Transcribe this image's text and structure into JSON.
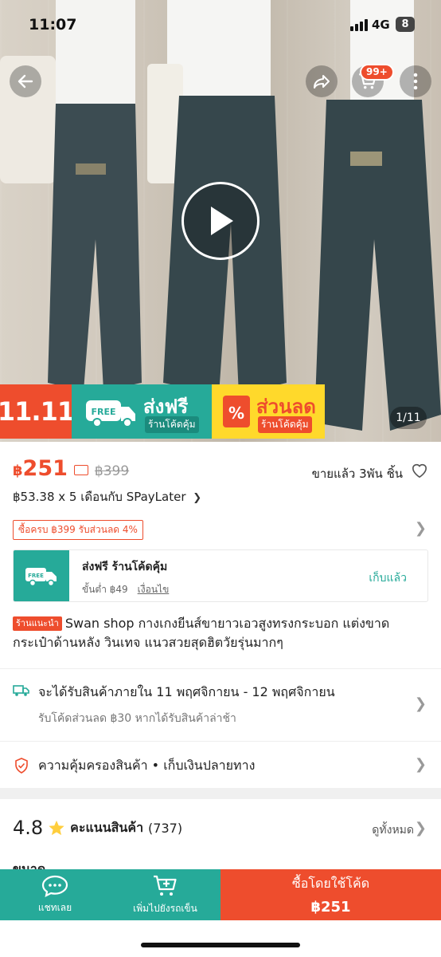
{
  "status_bar": {
    "time": "11:07",
    "network": "4G",
    "battery": "8"
  },
  "hero": {
    "image_pager": "1/11",
    "cart_badge": "99+"
  },
  "icons": {
    "back": "back-arrow-icon",
    "share": "share-icon",
    "cart": "cart-icon",
    "more": "more-dots-icon",
    "play": "play-icon",
    "heart": "heart-icon",
    "truck": "truck-icon",
    "shield": "shield-icon",
    "star": "star-icon",
    "chat": "chat-icon",
    "add_cart": "add-cart-icon"
  },
  "banner": {
    "event": "11.11",
    "free_badge": "FREE",
    "free_shipping": "ส่งฟรี",
    "free_shipping_sub": "ร้านโค้ดคุ้ม",
    "discount_icon": "%",
    "discount": "ส่วนลด",
    "discount_sub": "ร้านโค้ดคุ้ม"
  },
  "price": {
    "currency": "฿",
    "current": "251",
    "original": "฿399",
    "sold": "ขายแล้ว 3พัน ชิ้น",
    "installment": "฿53.38 x 5 เดือนกับ SPayLater",
    "promo": "ซื้อครบ ฿399 รับส่วนลด 4%"
  },
  "voucher": {
    "icon_label": "FREE",
    "title": "ส่งฟรี ร้านโค้ดคุ้ม",
    "min_spend": "ขั้นต่ำ ฿49",
    "conditions": "เงื่อนไข",
    "collect": "เก็บแล้ว"
  },
  "product": {
    "badge": "ร้านแนะนำ",
    "title": "Swan shop กางเกงยีนส์ขายาวเอวสูงทรงกระบอก แต่งขาดกระเป๋าด้านหลัง วินเทจ แนวสวยสุดฮิตวัยรุ่นมากๆ"
  },
  "shipping": {
    "estimate": "จะได้รับสินค้าภายใน 11 พฤศจิกายน - 12 พฤศจิกายน",
    "late_voucher": "รับโค้ดส่วนลด ฿30 หากได้รับสินค้าล่าช้า"
  },
  "guarantee": {
    "text": "ความคุ้มครองสินค้า  •  เก็บเงินปลายทาง"
  },
  "rating": {
    "score": "4.8",
    "label": "คะแนนสินค้า",
    "count": "(737)",
    "see_all": "ดูทั้งหมด"
  },
  "size_section": {
    "peek": "ขนาด"
  },
  "bottom_bar": {
    "chat": "แชทเลย",
    "add_to_cart": "เพิ่มไปยังรถเข็น",
    "buy_with_code": "ซื้อโดยใช้โค้ด",
    "buy_price": "฿251"
  },
  "colors": {
    "shopee_orange": "#ee4d2d",
    "teal": "#26aa99",
    "yellow": "#ffd92b"
  }
}
